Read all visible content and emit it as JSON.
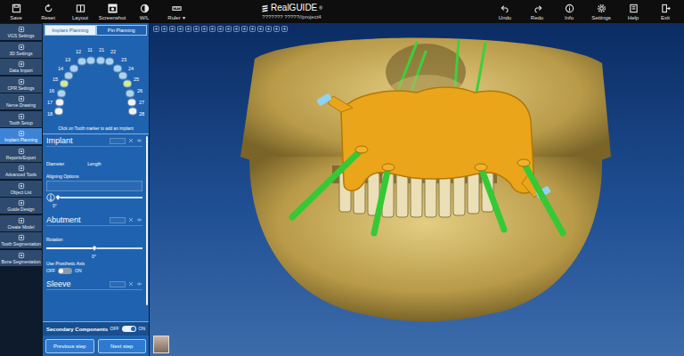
{
  "toolbar": {
    "left": [
      {
        "label": "Save"
      },
      {
        "label": "Reset"
      },
      {
        "label": "Layout"
      },
      {
        "label": "Screenshot"
      },
      {
        "label": "W/L"
      },
      {
        "label": "Ruler",
        "arrow": "▾"
      }
    ],
    "right": [
      {
        "label": "Undo"
      },
      {
        "label": "Redo"
      },
      {
        "label": "Info"
      },
      {
        "label": "Settings"
      },
      {
        "label": "Help"
      },
      {
        "label": "Exit"
      }
    ]
  },
  "app": {
    "logo": "RealGUIDE",
    "logo_mark": "®",
    "project": "??????? ?????//project4"
  },
  "nav": [
    {
      "label": "VGS Settings",
      "selected": false
    },
    {
      "label": "3D Settings",
      "selected": false
    },
    {
      "label": "Data Import",
      "selected": false
    },
    {
      "label": "CPR Settings",
      "selected": false
    },
    {
      "label": "Nerve Drawing",
      "selected": false
    },
    {
      "label": "Tooth Setup",
      "selected": false
    },
    {
      "label": "Implant Planning",
      "selected": true
    },
    {
      "label": "Reports/Export",
      "selected": false
    },
    {
      "label": "Advanced Tools",
      "selected": false
    },
    {
      "label": "Object List",
      "selected": false
    },
    {
      "label": "Guide Design",
      "selected": false
    },
    {
      "label": "Create Model",
      "selected": false
    },
    {
      "label": "Tooth Segmentation",
      "selected": false
    },
    {
      "label": "Bone Segmentation",
      "selected": false
    }
  ],
  "panel": {
    "tabs": [
      {
        "label": "Implant Planning",
        "selected": true
      },
      {
        "label": "Pin Planning",
        "selected": false
      }
    ],
    "teeth": [
      {
        "number": "11",
        "color": "#a9d3ef"
      },
      {
        "number": "12",
        "color": "#a9d3ef"
      },
      {
        "number": "13",
        "color": "#a9d3ef"
      },
      {
        "number": "14",
        "color": "#a9d3ef"
      },
      {
        "number": "15",
        "color": "#cdeb9c"
      },
      {
        "number": "16",
        "color": "#a9d3ef"
      },
      {
        "number": "17",
        "color": "#f2f2f2"
      },
      {
        "number": "18",
        "color": "#f2f2f2"
      },
      {
        "number": "21",
        "color": "#a9d3ef"
      },
      {
        "number": "22",
        "color": "#a9d3ef"
      },
      {
        "number": "23",
        "color": "#a9d3ef"
      },
      {
        "number": "24",
        "color": "#a9d3ef"
      },
      {
        "number": "25",
        "color": "#cdeb9c"
      },
      {
        "number": "26",
        "color": "#a9d3ef"
      },
      {
        "number": "27",
        "color": "#f2f2f2"
      },
      {
        "number": "28",
        "color": "#f2f2f2"
      }
    ],
    "hint": "Click on Tooth marker to add an implant",
    "implant": {
      "title": "Implant",
      "fields": [
        "Diameter",
        "Length"
      ],
      "aligning_label": "Aligning Options",
      "slider": {
        "level": 0,
        "reading": "0°"
      }
    },
    "abutment": {
      "title": "Abutment",
      "rotation_label": "Rotation",
      "slider": {
        "level": 0.5,
        "reading": "0°"
      },
      "prosthetic_axis": {
        "label": "Use Prosthetic Axis",
        "off": "OFF",
        "on": "ON",
        "checked": false
      }
    },
    "sleeve": {
      "title": "Sleeve"
    },
    "secondary": {
      "label": "Secondary Components",
      "off": "OFF",
      "on": "ON",
      "checked": true
    },
    "buttons": [
      "Previous step",
      "Next step"
    ]
  }
}
